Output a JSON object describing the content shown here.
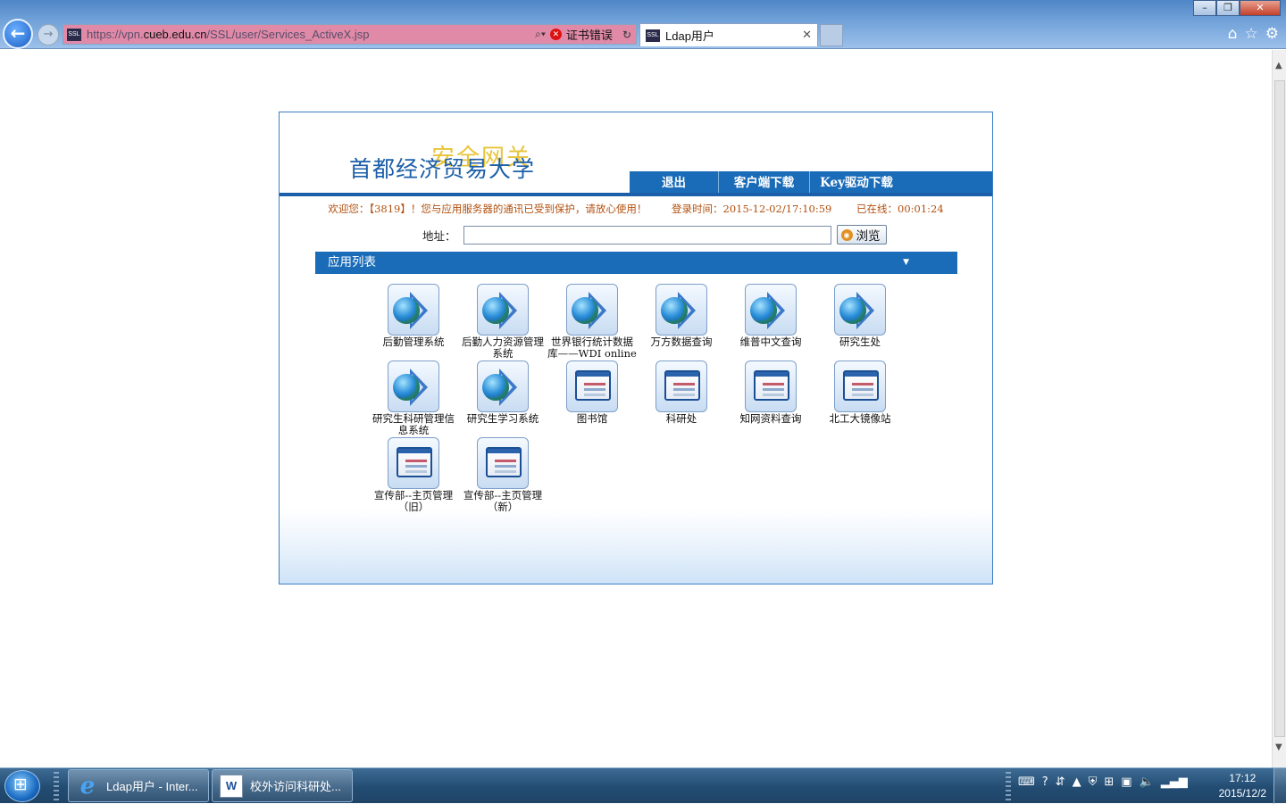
{
  "browser": {
    "url_prefix": "https://vpn.",
    "url_domain": "cueb.edu.cn",
    "url_path": "/SSL/user/Services_ActiveX.jsp",
    "cert_error": "证书错误",
    "tab_title": "Ldap用户",
    "ssl_badge": "SSL"
  },
  "header": {
    "logo_main": "首都经济贸易大学",
    "logo_overlay": "安全网关",
    "nav": [
      "退出",
      "客户端下载",
      "Key驱动下载"
    ]
  },
  "status": {
    "welcome": "欢迎您：【3819】！您与应用服务器的通讯已受到保护，请放心使用！",
    "login_time": "登录时间：2015-12-02/17:10:59",
    "online": "已在线：00:01:24"
  },
  "address_bar": {
    "label": "地址：",
    "value": "",
    "browse": "浏览"
  },
  "app_list": {
    "title": "应用列表",
    "apps": [
      {
        "label": "后勤管理系统",
        "icon": "globe-arrow-icon"
      },
      {
        "label": "后勤人力资源管理系统",
        "icon": "globe-arrow-icon"
      },
      {
        "label": "世界银行统计数据库——WDI online",
        "icon": "globe-arrow-icon"
      },
      {
        "label": "万方数据查询",
        "icon": "globe-arrow-icon"
      },
      {
        "label": "维普中文查询",
        "icon": "globe-arrow-icon"
      },
      {
        "label": "研究生处",
        "icon": "globe-arrow-icon"
      },
      {
        "label": "研究生科研管理信息系统",
        "icon": "globe-arrow-icon"
      },
      {
        "label": "研究生学习系统",
        "icon": "globe-arrow-icon"
      },
      {
        "label": "图书馆",
        "icon": "window-icon"
      },
      {
        "label": "科研处",
        "icon": "window-icon"
      },
      {
        "label": "知网资料查询",
        "icon": "window-icon"
      },
      {
        "label": "北工大镜像站",
        "icon": "window-icon"
      },
      {
        "label": "宣传部--主页管理（旧）",
        "icon": "window-icon"
      },
      {
        "label": "宣传部--主页管理（新）",
        "icon": "window-icon"
      }
    ]
  },
  "taskbar": {
    "tasks": [
      "Ldap用户 - Inter...",
      "校外访问科研处..."
    ],
    "time": "17:12",
    "date": "2015/12/2"
  },
  "colors": {
    "accent_blue": "#1a6cb8",
    "status_text": "#b1500f",
    "logo_gold": "#e8c43a"
  }
}
